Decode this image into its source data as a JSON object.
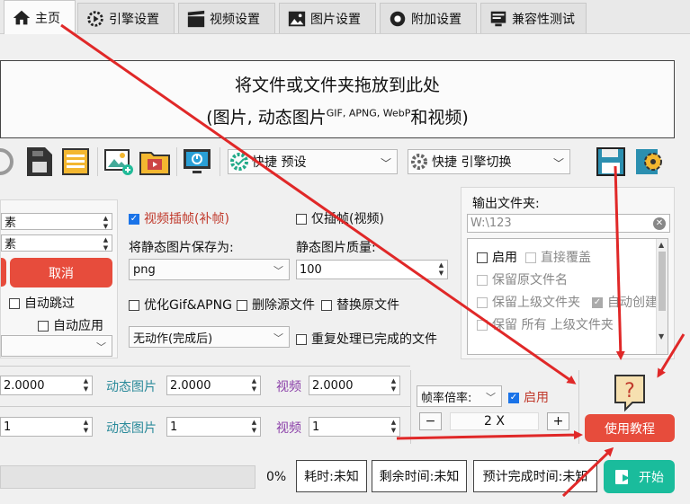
{
  "tabs": [
    {
      "label": "主页",
      "icon": "home-icon"
    },
    {
      "label": "引擎设置",
      "icon": "engine-settings-icon"
    },
    {
      "label": "视频设置",
      "icon": "video-clapper-icon"
    },
    {
      "label": "图片设置",
      "icon": "image-icon"
    },
    {
      "label": "附加设置",
      "icon": "addon-settings-icon"
    },
    {
      "label": "兼容性测试",
      "icon": "compatibility-test-icon"
    }
  ],
  "drop_zone": {
    "line1": "将文件或文件夹拖放到此处",
    "line2_prefix": "(图片, 动态图片",
    "line2_sup": "GIF, APNG, WebP",
    "line2_suffix": "和视频)"
  },
  "toolbar": {
    "preset_combo": "快捷 预设",
    "engine_combo": "快捷 引擎切换"
  },
  "left_panel": {
    "field1": "素",
    "field2": "素",
    "cancel_label": "取消",
    "auto_skip_label": "自动跳过",
    "auto_apply_label": "自动应用"
  },
  "middle_panel": {
    "video_interp_label": "视频插帧(补帧)",
    "interp_only_label": "仅插帧(视频)",
    "save_static_label": "将静态图片保存为:",
    "static_quality_label": "静态图片质量:",
    "format_value": "png",
    "quality_value": "100",
    "optimize_gif_label": "优化Gif&APNG",
    "delete_source_label": "删除源文件",
    "replace_source_label": "替换原文件",
    "after_action_value": "无动作(完成后)",
    "reprocess_label": "重复处理已完成的文件"
  },
  "output_panel": {
    "title": "输出文件夹:",
    "path_value": "W:\\123",
    "options": [
      {
        "label": "启用",
        "checked": false
      },
      {
        "label": "直接覆盖",
        "checked": false
      },
      {
        "label": "保留原文件名",
        "checked": false
      },
      {
        "label": "保留上级文件夹",
        "checked": false
      },
      {
        "label": "自动创建",
        "checked": true
      },
      {
        "label": "保留  所有  上级文件夹",
        "checked": false
      }
    ]
  },
  "scale_row1": {
    "first_value": "2.0000",
    "anim_label": "动态图片",
    "anim_value": "2.0000",
    "video_label": "视频",
    "video_value": "2.0000"
  },
  "scale_row2": {
    "first_value": "1",
    "anim_label": "动态图片",
    "anim_value": "1",
    "video_label": "视频",
    "video_value": "1"
  },
  "framerate": {
    "select_label": "帧率倍率:",
    "enable_label": "启用",
    "enabled": true,
    "minus": "−",
    "value": "2 X",
    "plus": "+"
  },
  "tutorial": {
    "label": "使用教程"
  },
  "status": {
    "progress_percent": "0%",
    "progress_value": 0,
    "elapsed": "耗时:未知",
    "remaining": "剩余时间:未知",
    "eta": "预计完成时间:未知",
    "start_label": "开始"
  },
  "colors": {
    "accent_red": "#e74c3c",
    "start_green": "#1abc9c",
    "annotation_red": "#e02828"
  }
}
